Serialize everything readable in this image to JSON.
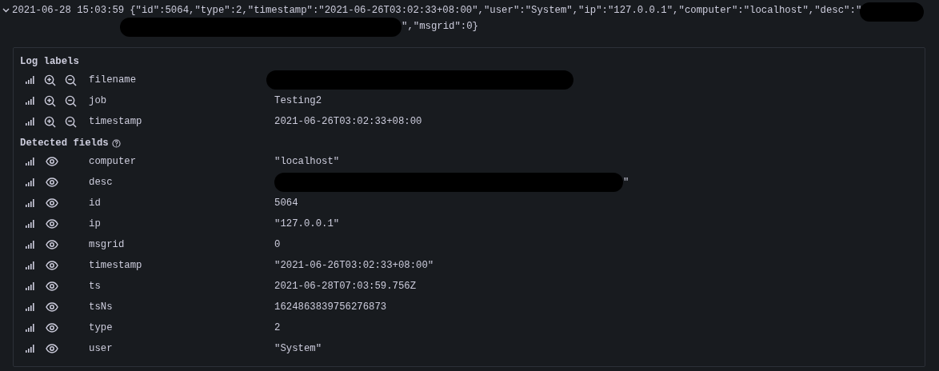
{
  "log_line": {
    "expanded": true,
    "time": "2021-06-28 15:03:59",
    "message_start": "{\"id\":5064,\"type\":2,\"timestamp\":\"2021-06-26T03:02:33+08:00\",\"user\":\"System\",\"ip\":\"127.0.0.1\",\"computer\":\"localhost\",\"desc\":\"",
    "message_end": "\",\"msgrid\":0}"
  },
  "log_labels": {
    "title": "Log labels",
    "items": [
      {
        "key": "filename",
        "redacted": true
      },
      {
        "key": "job",
        "value": "Testing2",
        "redacted": false
      },
      {
        "key": "timestamp",
        "value": "2021-06-26T03:02:33+08:00",
        "redacted": false
      }
    ]
  },
  "detected_fields": {
    "title": "Detected fields",
    "items": [
      {
        "key": "computer",
        "value": "\"localhost\"",
        "redacted": false
      },
      {
        "key": "desc",
        "value": "\"",
        "redacted": true
      },
      {
        "key": "id",
        "value": "5064",
        "redacted": false
      },
      {
        "key": "ip",
        "value": "\"127.0.0.1\"",
        "redacted": false
      },
      {
        "key": "msgrid",
        "value": "0",
        "redacted": false
      },
      {
        "key": "timestamp",
        "value": "\"2021-06-26T03:02:33+08:00\"",
        "redacted": false
      },
      {
        "key": "ts",
        "value": "2021-06-28T07:03:59.756Z",
        "redacted": false
      },
      {
        "key": "tsNs",
        "value": "1624863839756276873",
        "redacted": false
      },
      {
        "key": "type",
        "value": "2",
        "redacted": false
      },
      {
        "key": "user",
        "value": "\"System\"",
        "redacted": false
      }
    ]
  }
}
